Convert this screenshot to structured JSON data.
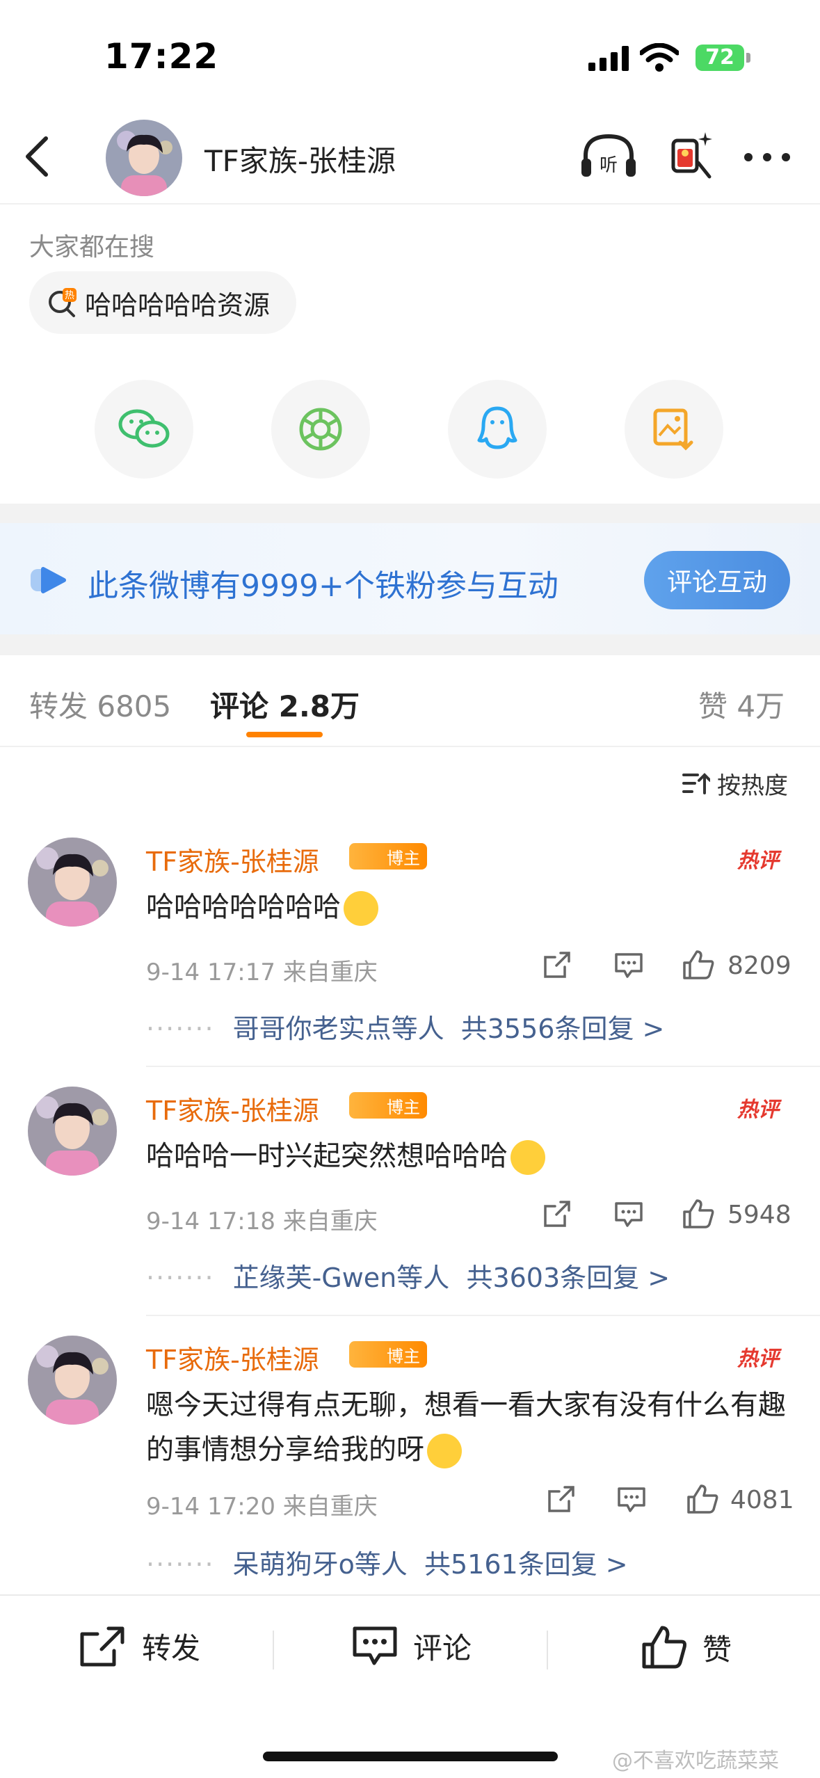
{
  "status_bar": {
    "time": "17:22",
    "battery": "72"
  },
  "header": {
    "title": "TF家族-张桂源"
  },
  "search": {
    "caption": "大家都在搜",
    "hot_term": "哈哈哈哈哈资源"
  },
  "share": [
    "wechat-icon",
    "moments-icon",
    "qq-icon",
    "save-image-icon"
  ],
  "banner": {
    "text": "此条微博有9999+个铁粉参与互动",
    "button": "评论互动"
  },
  "tabs": {
    "repost": "转发 6805",
    "comment": "评论 2.8万",
    "like": "赞 4万"
  },
  "sort_label": "按热度",
  "badge_label": "博主",
  "hot_label": "热评",
  "comments": [
    {
      "name": "TF家族-张桂源",
      "text": "哈哈哈哈哈哈哈",
      "time": "9-14 17:17",
      "location": "来自重庆",
      "likes": "8209",
      "reply_user": "哥哥你老实点等人",
      "reply_count": "共3556条回复 >"
    },
    {
      "name": "TF家族-张桂源",
      "text": "哈哈哈一时兴起突然想哈哈哈",
      "time": "9-14 17:18",
      "location": "来自重庆",
      "likes": "5948",
      "reply_user": "芷缘芙-Gwen等人",
      "reply_count": "共3603条回复 >"
    },
    {
      "name": "TF家族-张桂源",
      "text": "嗯今天过得有点无聊，想看一看大家有没有什么有趣的事情想分享给我的呀",
      "time": "9-14 17:20",
      "location": "来自重庆",
      "likes": "4081",
      "reply_user": "呆萌狗牙o等人",
      "reply_count": "共5161条回复 >"
    }
  ],
  "bottom_bar": {
    "repost": "转发",
    "comment": "评论",
    "like": "赞"
  },
  "watermark": "@不喜欢吃蔬菜菜"
}
